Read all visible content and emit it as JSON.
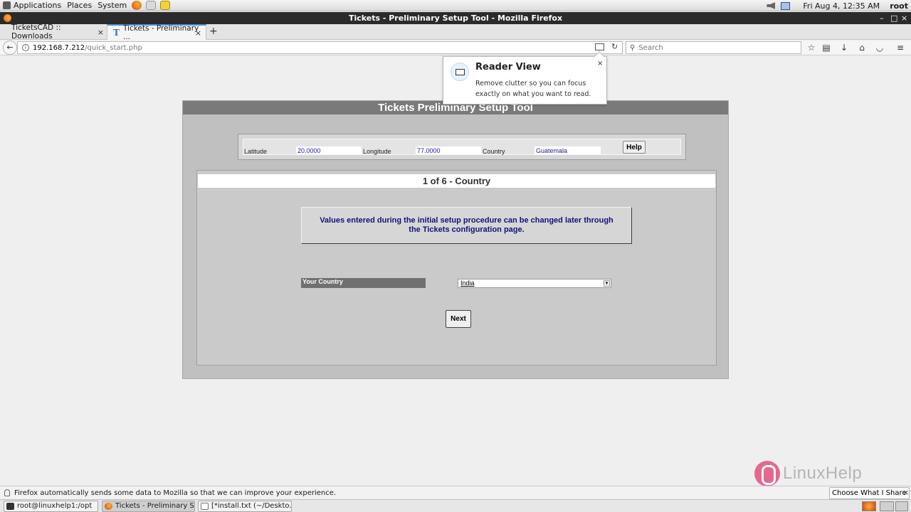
{
  "top_panel": {
    "menus": [
      "Applications",
      "Places",
      "System"
    ],
    "clock": "Fri Aug  4, 12:35 AM",
    "user": "root"
  },
  "window": {
    "title": "Tickets - Preliminary Setup Tool - Mozilla Firefox",
    "controls": [
      "–",
      "□",
      "×"
    ]
  },
  "tabs": [
    {
      "label": "TicketsCAD :: Downloads",
      "active": false
    },
    {
      "label": "Tickets - Preliminary ...",
      "active": true
    }
  ],
  "nav": {
    "url_host": "192.168.7.212",
    "url_path": "/quick_start.php",
    "search_placeholder": "Search"
  },
  "page": {
    "title": "Tickets Preliminary Setup Tool",
    "coords": {
      "latitude_label": "Latitude",
      "latitude_value": "20.0000",
      "longitude_label": "Longitude",
      "longitude_value": "77.0000",
      "country_label": "Country",
      "country_value": "Guatemala",
      "help_label": "Help"
    },
    "step": {
      "header": "1 of 6 - Country",
      "info": "Values entered during the initial setup procedure can be changed later through the Tickets configuration page.",
      "field_label": "Your Country",
      "selected_country": "India",
      "next_label": "Next"
    }
  },
  "reader_popup": {
    "title": "Reader View",
    "description": "Remove clutter so you can focus exactly on what you want to read.",
    "close": "×"
  },
  "watermark": "LinuxHelp",
  "notification": {
    "text": "Firefox automatically sends some data to Mozilla so that we can improve your experience.",
    "button": "Choose What I Share",
    "close": "×"
  },
  "taskbar": {
    "items": [
      "root@linuxhelp1:/opt",
      "Tickets - Preliminary S...",
      "[*install.txt (~/Deskto..."
    ]
  },
  "colors": {
    "page_title_bg": "#7a7a7a",
    "info_text": "#12127a",
    "value_text": "#1c1c9a"
  }
}
